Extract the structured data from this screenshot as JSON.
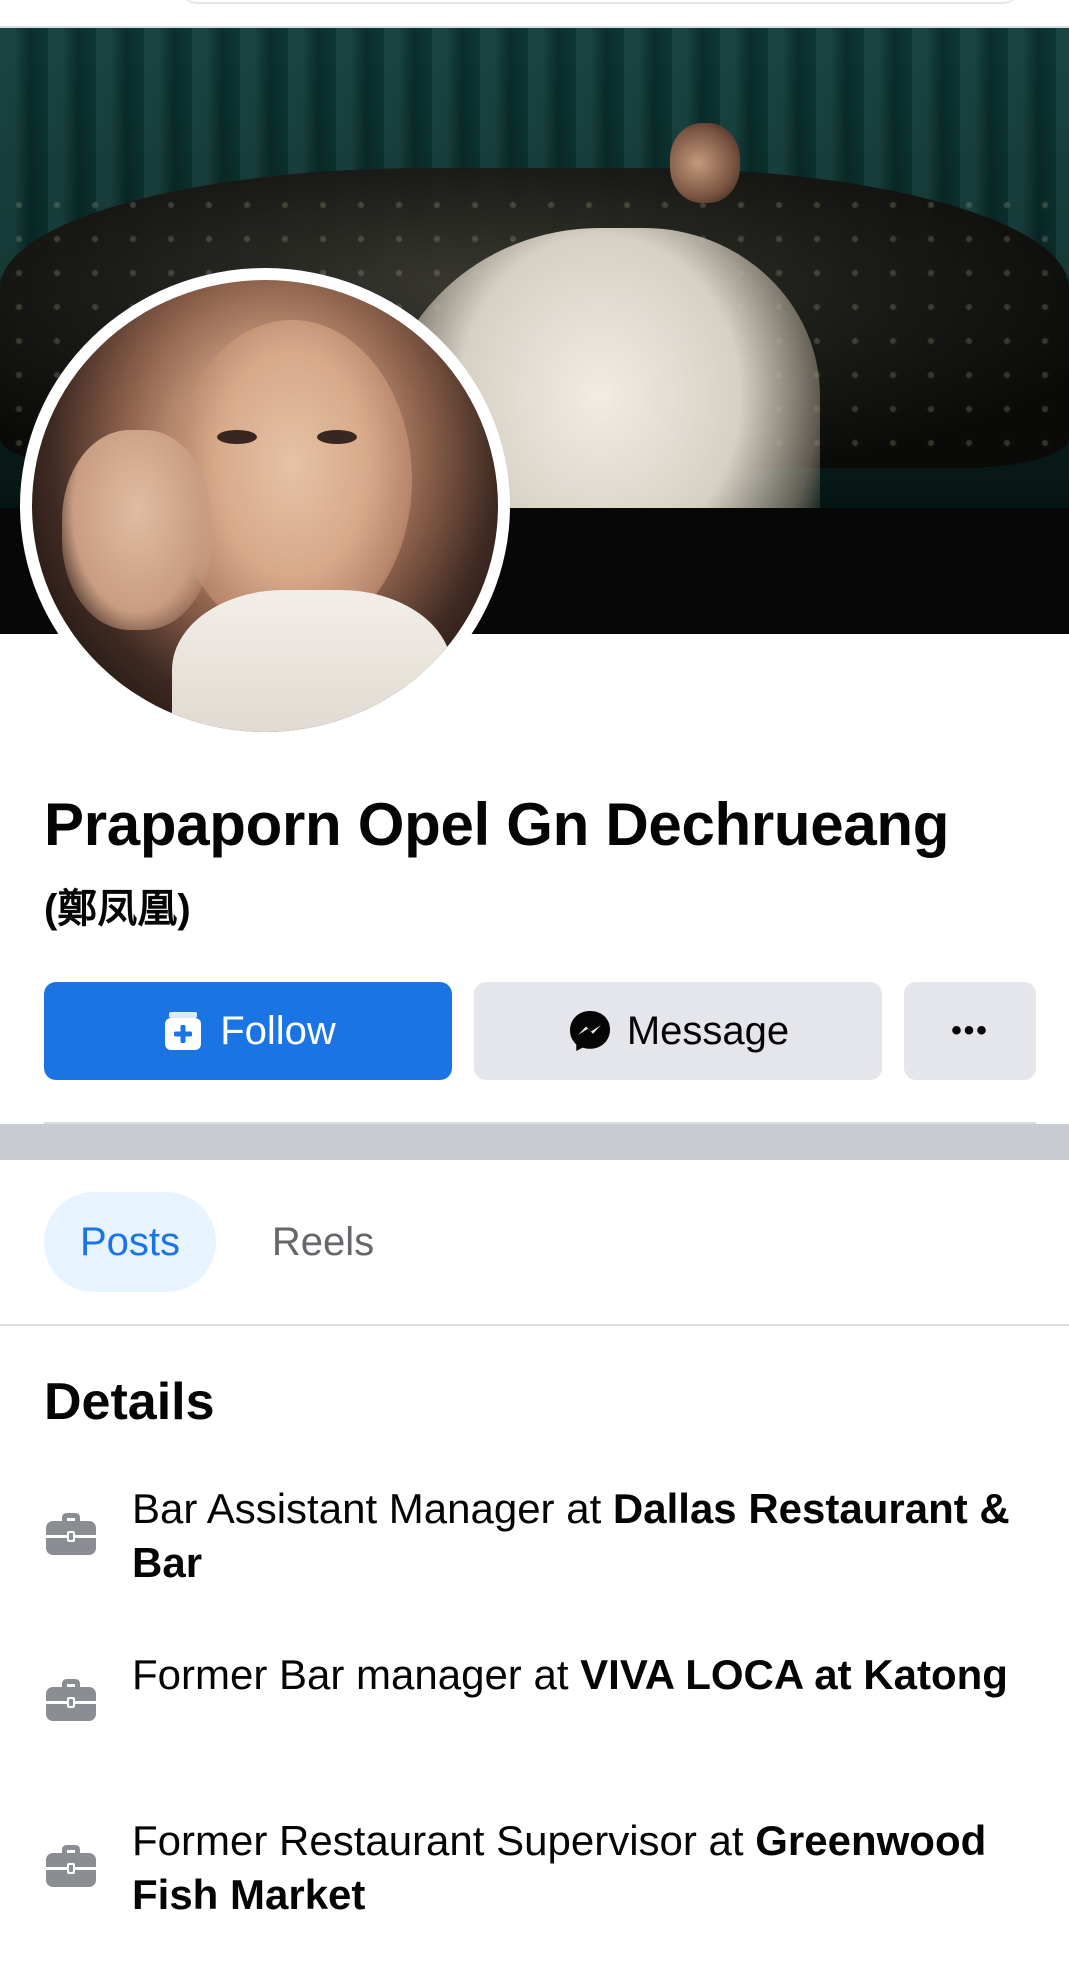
{
  "profile": {
    "name": "Prapaporn Opel Gn Dechrueang",
    "alt_name": "(鄭凤凰)"
  },
  "actions": {
    "follow_label": "Follow",
    "message_label": "Message",
    "more_label": "•••"
  },
  "tabs": [
    {
      "label": "Posts",
      "selected": true
    },
    {
      "label": "Reels",
      "selected": false
    }
  ],
  "details": {
    "title": "Details",
    "items": [
      {
        "prefix": "Bar Assistant Manager at ",
        "place": "Dallas Restaurant & Bar",
        "icon": "briefcase-icon"
      },
      {
        "prefix": "Former Bar manager at ",
        "place": "VIVA LOCA at Katong",
        "icon": "briefcase-icon"
      },
      {
        "prefix": "Former Restaurant Supervisor at ",
        "place": "Greenwood Fish Market",
        "icon": "briefcase-icon"
      }
    ]
  },
  "colors": {
    "accent": "#1b74e4",
    "secondary_button": "#e4e6eb",
    "selected_tab_bg": "#e7f3ff",
    "muted_text": "#65676b",
    "icon_gray": "#8a8d91"
  }
}
